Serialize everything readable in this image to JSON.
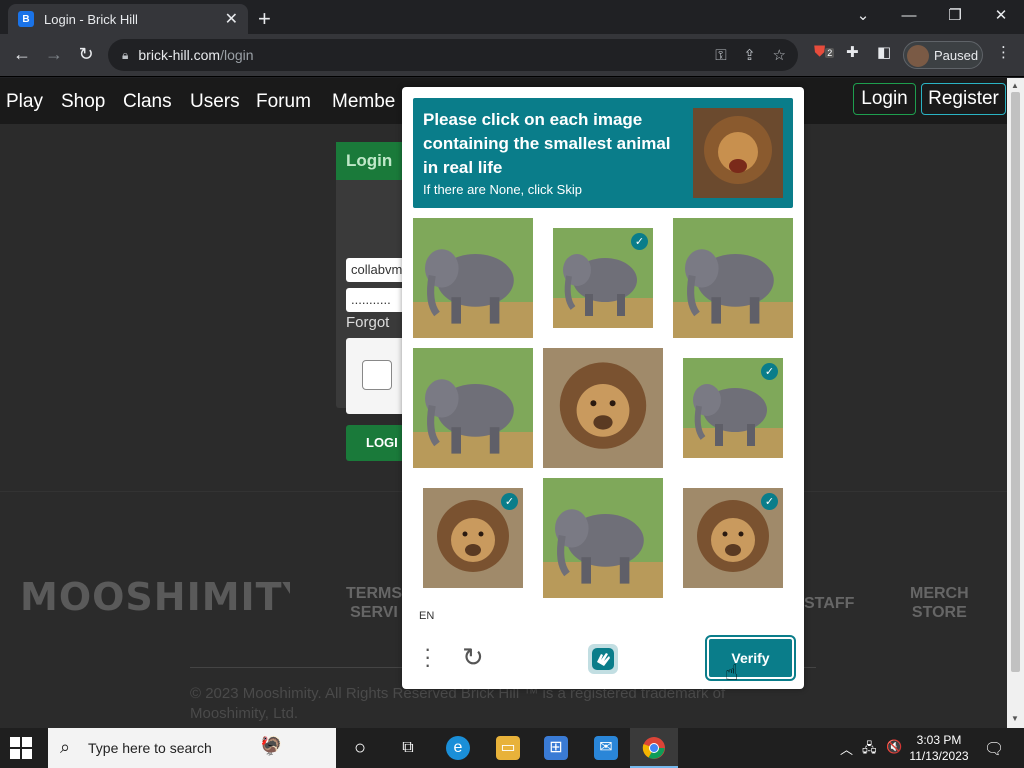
{
  "browser": {
    "tab_title": "Login - Brick Hill",
    "favicon_letter": "B",
    "url_host": "brick-hill.com",
    "url_path": "/login",
    "profile_label": "Paused",
    "ext_badge": "2"
  },
  "site": {
    "nav": [
      "Play",
      "Shop",
      "Clans",
      "Users",
      "Forum",
      "Membe"
    ],
    "login_label": "Login",
    "register_label": "Register",
    "login_box": {
      "header": "Login",
      "username_value": "collabvm",
      "password_value": "...........",
      "forgot": "Forgot",
      "login_button": "LOGI"
    },
    "footer": {
      "logo": "MOOSHIMITY",
      "link_terms_1": "TERMS",
      "link_terms_2": "SERVI",
      "link_staff": "STAFF",
      "link_merch_1": "MERCH",
      "link_merch_2": "STORE",
      "copyright_1": "© 2023 Mooshimity. All Rights Reserved Brick Hill ™ is a registered trademark of",
      "copyright_2": "Mooshimity, Ltd."
    }
  },
  "captcha": {
    "prompt": "Please click on each image containing the smallest animal in real life",
    "sub": "If there are None, click Skip",
    "language": "EN",
    "verify_label": "Verify",
    "tiles": [
      {
        "animal": "elephant",
        "selected": false
      },
      {
        "animal": "elephant",
        "selected": true
      },
      {
        "animal": "elephant",
        "selected": false
      },
      {
        "animal": "elephant",
        "selected": false
      },
      {
        "animal": "lion",
        "selected": false
      },
      {
        "animal": "elephant",
        "selected": true
      },
      {
        "animal": "lion",
        "selected": true
      },
      {
        "animal": "elephant",
        "selected": false
      },
      {
        "animal": "lion",
        "selected": true
      }
    ]
  },
  "taskbar": {
    "search_placeholder": "Type here to search",
    "time": "3:03 PM",
    "date": "11/13/2023"
  }
}
